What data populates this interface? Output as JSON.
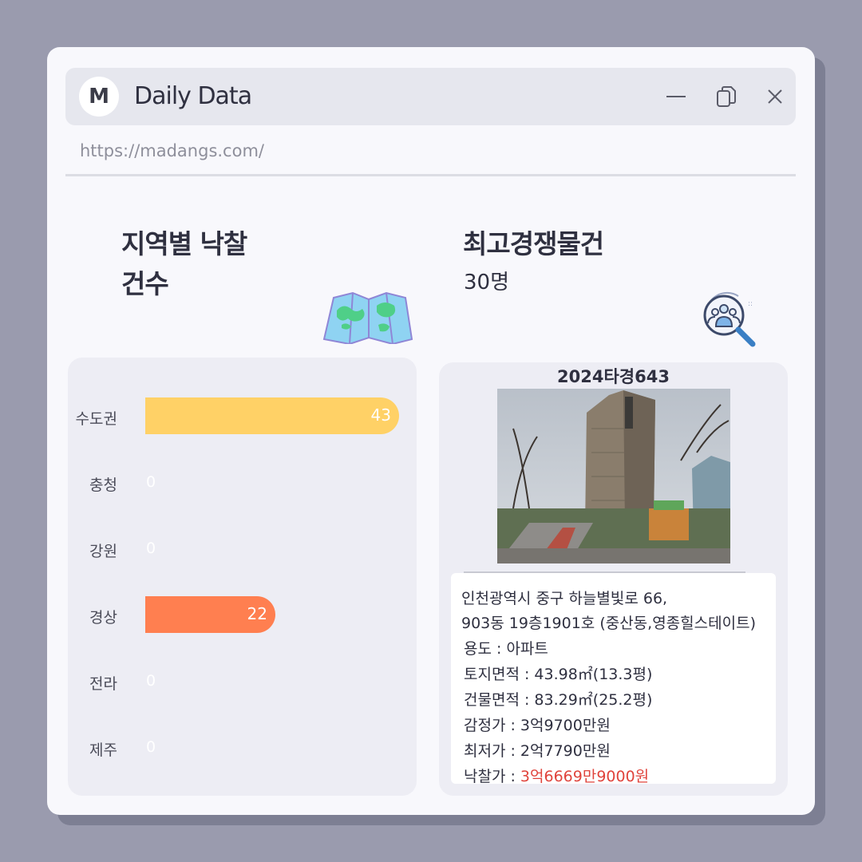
{
  "window": {
    "avatar_letter": "M",
    "title": "Daily Data",
    "url": "https://madangs.com/"
  },
  "left": {
    "heading_line1": "지역별 낙찰",
    "heading_line2": "건수",
    "icon": "map-icon"
  },
  "right": {
    "heading": "최고경쟁물건",
    "count": "30명",
    "icon": "people-search-icon"
  },
  "chart_data": {
    "type": "bar",
    "categories": [
      "수도권",
      "충청",
      "강원",
      "경상",
      "전라",
      "제주"
    ],
    "values": [
      43,
      0,
      0,
      22,
      0,
      0
    ],
    "colors": [
      "#ffd166",
      null,
      null,
      "#ff7f50",
      null,
      null
    ]
  },
  "case": {
    "number": "2024타경643",
    "address1": "인천광역시 중구 하늘별빛로 66,",
    "address2": "903동 19층1901호 (중산동,영종힐스테이트)",
    "usage": "용도 : 아파트",
    "land_area": "토지면적 : 43.98㎡(13.3평)",
    "building_area": "건물면적 : 83.29㎡(25.2평)",
    "appraisal": "감정가 : 3억9700만원",
    "minimum": "최저가 : 2억7790만원",
    "winning_label": "낙찰가 : ",
    "winning_value": "3억6669만9000원"
  }
}
